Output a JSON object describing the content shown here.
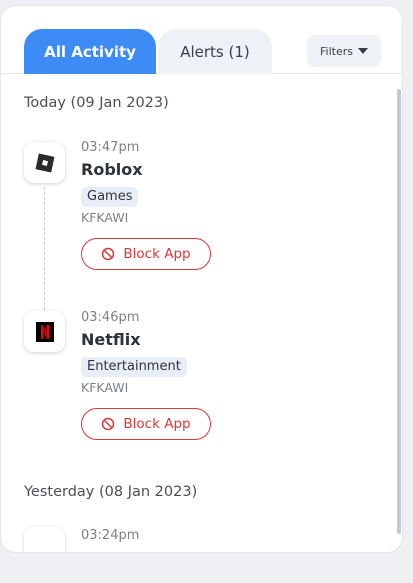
{
  "tabs": {
    "all_activity": "All Activity",
    "alerts": "Alerts (1)"
  },
  "filters": {
    "label": "Filters",
    "icon": "caret-down-icon"
  },
  "groups": [
    {
      "date": "Today (09 Jan 2023)",
      "items": [
        {
          "time": "03:47pm",
          "app": "Roblox",
          "category": "Games",
          "device": "KFKAWI",
          "icon": "roblox-icon",
          "action": "Block App"
        },
        {
          "time": "03:46pm",
          "app": "Netflix",
          "category": "Entertainment",
          "device": "KFKAWI",
          "icon": "netflix-icon",
          "action": "Block App"
        }
      ]
    },
    {
      "date": "Yesterday (08 Jan 2023)",
      "items": [
        {
          "time": "03:24pm"
        }
      ]
    }
  ],
  "colors": {
    "accent": "#3d8cf5",
    "danger": "#d63a3a",
    "tag_bg": "#e8eef7"
  }
}
